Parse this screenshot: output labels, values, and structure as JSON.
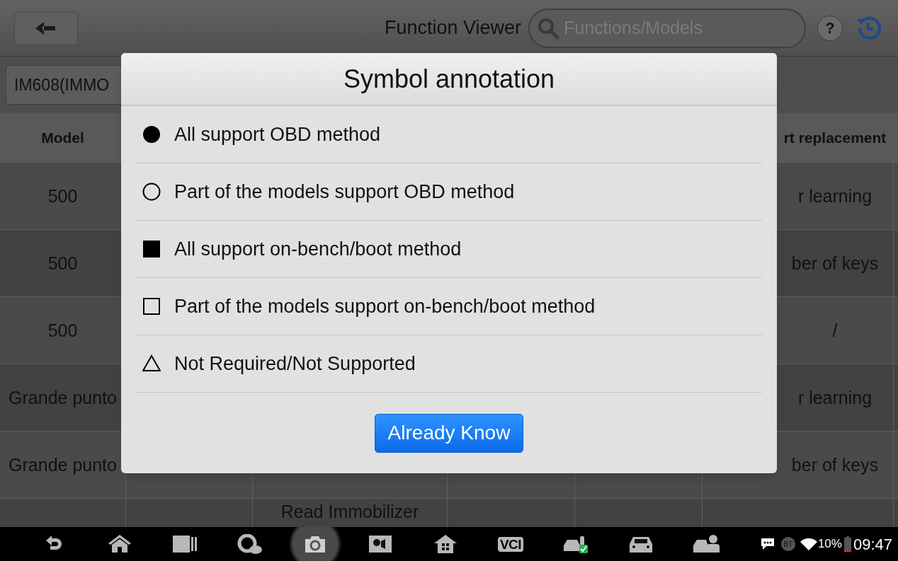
{
  "header": {
    "title": "Function Viewer",
    "search": {
      "placeholder": "Functions/Models"
    },
    "help_label": "?"
  },
  "selector": {
    "value": "IM608(IMMO"
  },
  "table": {
    "columns": [
      "Model",
      "",
      "",
      "",
      "",
      "rt replacement"
    ],
    "rows": [
      [
        "500",
        "",
        "",
        "",
        "",
        "r learning"
      ],
      [
        "500",
        "",
        "",
        "",
        "",
        "ber of keys"
      ],
      [
        "500",
        "",
        "",
        "",
        "",
        "/"
      ],
      [
        "Grande punto",
        "",
        "",
        "",
        "",
        "r learning"
      ],
      [
        "Grande punto",
        "",
        "",
        "",
        "",
        "ber of keys"
      ],
      [
        "",
        "",
        "Read Immobilizer",
        "",
        "",
        ""
      ]
    ]
  },
  "dialog": {
    "title": "Symbol annotation",
    "items": [
      {
        "kind": "filled-circle",
        "label": "All support OBD method"
      },
      {
        "kind": "hollow-circle",
        "label": "Part of the models support OBD method"
      },
      {
        "kind": "filled-square",
        "label": "All support on-bench/boot method"
      },
      {
        "kind": "hollow-square",
        "label": "Part of the models support on-bench/boot method"
      },
      {
        "kind": "triangle",
        "label": "Not Required/Not Supported"
      }
    ],
    "button": "Already Know"
  },
  "navbar": {
    "items": [
      {
        "kind": "back",
        "selected": false
      },
      {
        "kind": "home",
        "selected": false
      },
      {
        "kind": "recent",
        "selected": false
      },
      {
        "kind": "cloud",
        "selected": false
      },
      {
        "kind": "camera",
        "selected": true
      },
      {
        "kind": "display",
        "selected": false
      },
      {
        "kind": "house",
        "selected": false
      },
      {
        "kind": "vci",
        "selected": false,
        "label": "VCI"
      },
      {
        "kind": "car-key",
        "selected": false
      },
      {
        "kind": "car",
        "selected": false
      },
      {
        "kind": "car-person",
        "selected": false
      }
    ],
    "status": {
      "bt_label": "BT",
      "battery_text": "10%",
      "time": "09:47"
    }
  }
}
